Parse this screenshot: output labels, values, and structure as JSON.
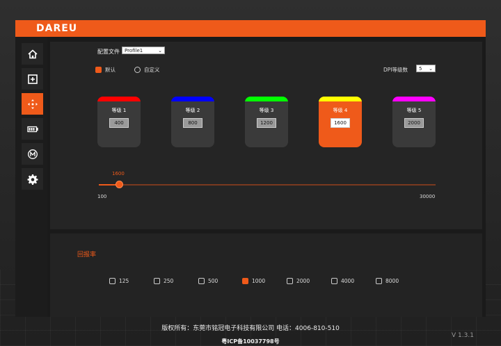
{
  "brand": {
    "logo": "DAREU",
    "accent": "#ef5a1a"
  },
  "sidebar": {
    "items": [
      {
        "id": "home",
        "icon": "home-icon"
      },
      {
        "id": "macro-add",
        "icon": "plus-square-icon"
      },
      {
        "id": "dpi",
        "icon": "move-arrows-icon",
        "active": true
      },
      {
        "id": "battery",
        "icon": "battery-icon"
      },
      {
        "id": "mode",
        "icon": "m-circle-icon"
      },
      {
        "id": "settings",
        "icon": "gear-icon"
      }
    ]
  },
  "profile": {
    "label": "配置文件",
    "selected": "Profile1"
  },
  "mode": {
    "default_label": "默认",
    "custom_label": "自定义",
    "selected": "default"
  },
  "dpi_count": {
    "label": "DPI等级数",
    "selected": "5"
  },
  "dpi_levels": [
    {
      "label": "等级 1",
      "value": "400",
      "color": "#ff0000"
    },
    {
      "label": "等级 2",
      "value": "800",
      "color": "#0000ff"
    },
    {
      "label": "等级 3",
      "value": "1200",
      "color": "#00ff00"
    },
    {
      "label": "等级 4",
      "value": "1600",
      "color": "#ffff00",
      "active": true
    },
    {
      "label": "等级 5",
      "value": "2000",
      "color": "#ff00ff"
    }
  ],
  "slider": {
    "value": "1600",
    "min": "100",
    "max": "30000"
  },
  "polling": {
    "title": "回报率",
    "options": [
      "125",
      "250",
      "500",
      "1000",
      "2000",
      "4000",
      "8000"
    ],
    "selected": "1000"
  },
  "footer": {
    "copyright": "版权所有：东莞市铭冠电子科技有限公司 电话：4006-810-510",
    "icp": "粤ICP备10037798号",
    "version": "V 1.3.1"
  }
}
